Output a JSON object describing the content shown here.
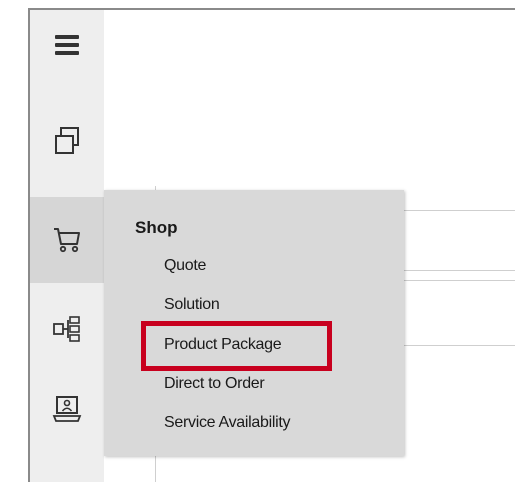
{
  "sidebar": {
    "items": [
      {
        "icon": "hamburger-menu-icon"
      },
      {
        "icon": "stacked-windows-icon"
      },
      {
        "icon": "shopping-cart-icon",
        "active": true
      },
      {
        "icon": "hierarchy-icon"
      },
      {
        "icon": "laptop-user-icon"
      }
    ]
  },
  "flyout": {
    "title": "Shop",
    "items": [
      {
        "label": "Quote"
      },
      {
        "label": "Solution"
      },
      {
        "label": "Product Package",
        "highlighted": true
      },
      {
        "label": "Direct to Order"
      },
      {
        "label": "Service Availability"
      }
    ]
  },
  "colors": {
    "highlight_border": "#c8001e",
    "flyout_bg": "#d9d9d9",
    "rail_bg": "#eeeeee",
    "active_bg": "#d6d6d6"
  }
}
